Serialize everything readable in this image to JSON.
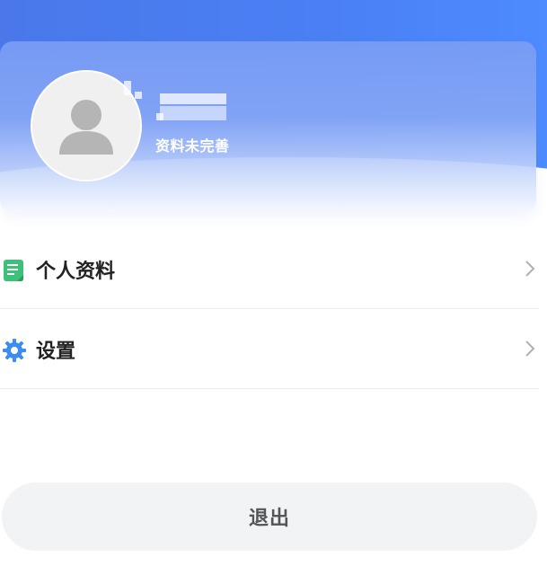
{
  "profile": {
    "status_text": "资料未完善"
  },
  "menu": {
    "items": [
      {
        "label": "个人资料",
        "icon": "document-icon"
      },
      {
        "label": "设置",
        "icon": "gear-icon"
      }
    ]
  },
  "logout_label": "退出",
  "colors": {
    "header_blue": "#4a80f4",
    "document_icon_green": "#3cc07a",
    "gear_icon_blue": "#3d8cf0",
    "logout_bg": "#f2f3f5"
  }
}
